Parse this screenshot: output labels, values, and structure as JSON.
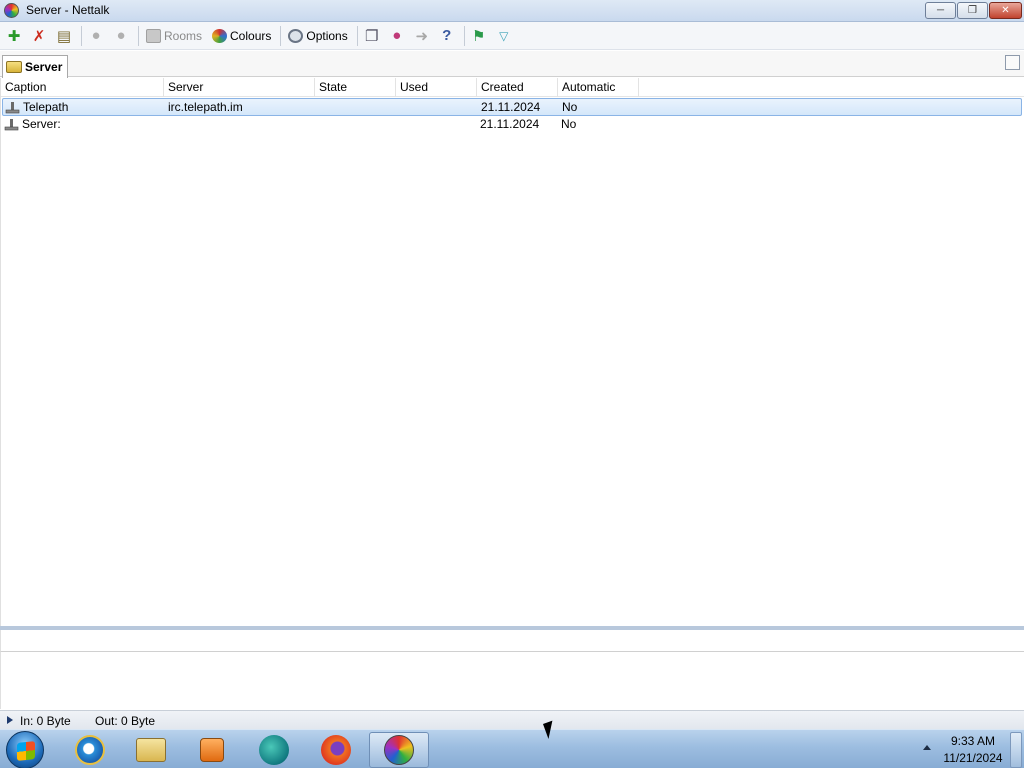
{
  "window": {
    "title": "Server  -  Nettalk",
    "icon": "nettalk-globe-icon",
    "controls": {
      "minimize": "minimize-icon",
      "maximize": "restore-icon",
      "close": "close-icon"
    }
  },
  "toolbar": {
    "icons": [
      "add-icon",
      "delete-icon",
      "properties-icon",
      "user-icon",
      "user-icon",
      "rooms-icon",
      "colours-icon",
      "options-icon",
      "window-icon",
      "users-icon",
      "export-icon",
      "help-icon",
      "connect-icon",
      "dropdown-icon"
    ],
    "rooms_label": "Rooms",
    "colours_label": "Colours",
    "options_label": "Options",
    "help_glyph": "?"
  },
  "tabs": [
    {
      "label": "Server"
    }
  ],
  "table": {
    "columns": [
      "Caption",
      "Server",
      "State",
      "Used",
      "Created",
      "Automatic"
    ],
    "rows": [
      {
        "caption": "Telepath",
        "server": "irc.telepath.im",
        "state": "",
        "used": "",
        "created": "21.11.2024",
        "automatic": "No",
        "selected": true
      },
      {
        "caption": "Server:",
        "server": "",
        "state": "",
        "used": "",
        "created": "21.11.2024",
        "automatic": "No",
        "selected": false
      }
    ]
  },
  "status": {
    "in_label": "In:  0 Byte",
    "out_label": "Out:  0 Byte"
  },
  "taskbar": {
    "apps": [
      "start-orb-icon",
      "internet-explorer-icon",
      "file-explorer-icon",
      "media-player-icon",
      "chat-app-icon",
      "firefox-icon",
      "nettalk-icon"
    ],
    "clock_time": "9:33 AM",
    "clock_date": "11/21/2024"
  },
  "colors": {
    "selection_bg": "#d4e7fa",
    "selection_border": "#8ab4e6",
    "taskbar": "#9cbde0",
    "close_button": "#c1432e"
  }
}
